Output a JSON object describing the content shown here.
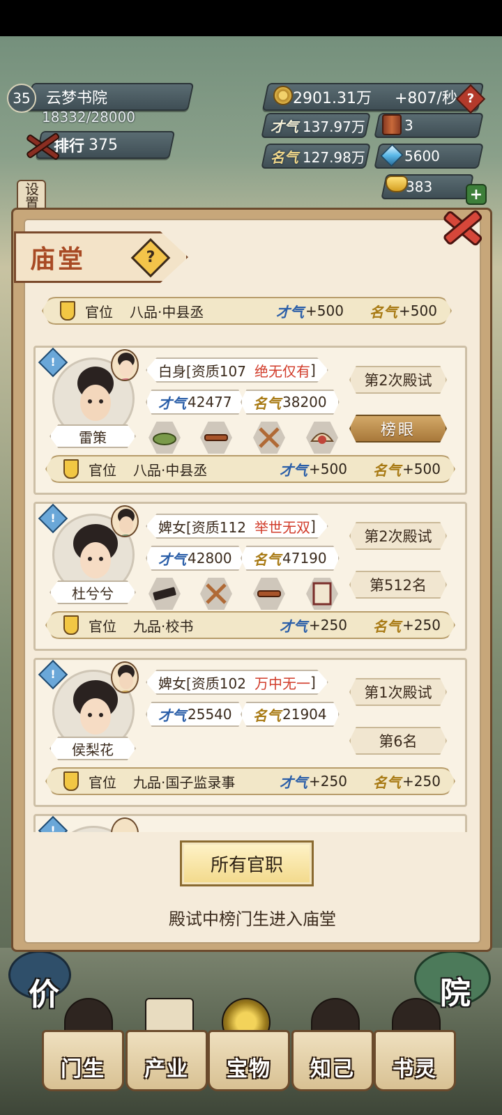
{
  "hud": {
    "level": "35",
    "academy_name": "云梦书院",
    "progress": "18332/28000",
    "rank_label": "排行",
    "rank_value": "375",
    "coins": "2901.31万",
    "coin_rate": "+807/秒",
    "talent_label": "才气",
    "talent_value": "137.97万",
    "fame_label": "名气",
    "fame_value": "127.98万",
    "scrolls": "3",
    "gems": "5600",
    "ingots": "383",
    "settings_label": "设置"
  },
  "panel": {
    "title": "庙堂",
    "help_glyph": "?",
    "all_posts_button": "所有官职",
    "footer_text": "殿试中榜门生进入庙堂"
  },
  "stat_labels": {
    "talent": "才气",
    "fame": "名气",
    "post": "官位"
  },
  "top_partial_row": {
    "post": "八品·中县丞",
    "talent": "+500",
    "fame": "+500"
  },
  "students": [
    {
      "name": "雷策",
      "status": "白身",
      "aptitude": "[资质107",
      "quality": "绝无仅有",
      "close": "]",
      "talent": "42477",
      "fame": "38200",
      "exam": "第2次殿试",
      "placement": "榜眼",
      "placement_style": "gold",
      "post": "八品·中县丞",
      "post_talent": "+500",
      "post_fame": "+500",
      "items": [
        "food-plate-icon",
        "flute-icon",
        "crossed-swords-icon",
        "pearl-shell-icon"
      ]
    },
    {
      "name": "杜兮兮",
      "status": "婢女",
      "aptitude": "[资质112",
      "quality": "举世无双",
      "close": "]",
      "talent": "42800",
      "fame": "47190",
      "exam": "第2次殿试",
      "placement": "第512名",
      "placement_style": "plain",
      "post": "九品·校书",
      "post_talent": "+250",
      "post_fame": "+250",
      "items": [
        "ink-stick-icon",
        "crossed-swords-icon",
        "flute-icon",
        "scroll-frame-icon"
      ]
    },
    {
      "name": "侯梨花",
      "status": "婢女",
      "aptitude": "[资质102",
      "quality": "万中无一",
      "close": "]",
      "talent": "25540",
      "fame": "21904",
      "exam": "第1次殿试",
      "placement": "第6名",
      "placement_style": "plain",
      "post": "九品·国子监录事",
      "post_talent": "+250",
      "post_fame": "+250",
      "items": []
    }
  ],
  "nav": [
    {
      "label": "门生",
      "icon": "student-figure-icon"
    },
    {
      "label": "产业",
      "icon": "map-scroll-icon"
    },
    {
      "label": "宝物",
      "icon": "treasure-compass-icon"
    },
    {
      "label": "知己",
      "icon": "confidant-figure-icon"
    },
    {
      "label": "书灵",
      "icon": "book-spirit-icon"
    }
  ],
  "side_buttons": {
    "left_char": "价",
    "right_char": "院"
  },
  "colors": {
    "quality_red": "#d13b2a",
    "talent_blue": "#2a5ea8",
    "fame_gold": "#a87a14",
    "title_brown": "#a84a24"
  }
}
